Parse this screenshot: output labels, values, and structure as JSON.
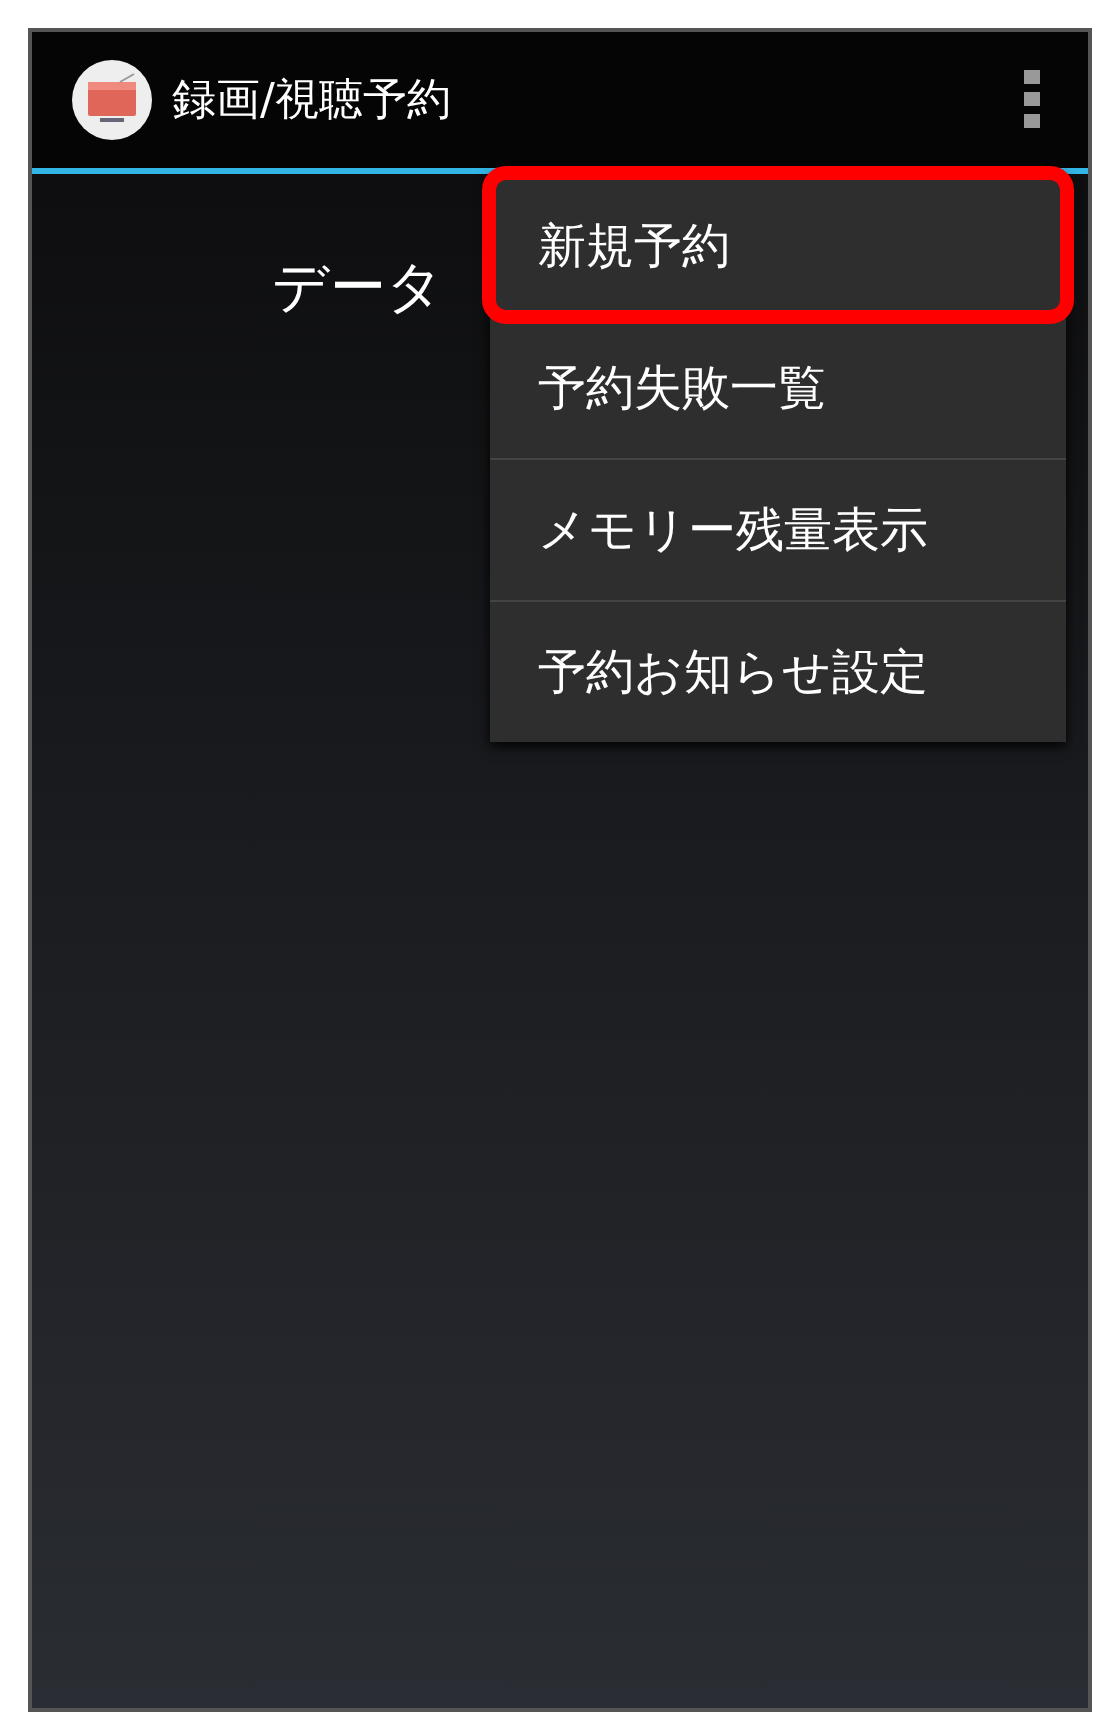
{
  "action_bar": {
    "title": "録画/視聴予約"
  },
  "body": {
    "message": "データ"
  },
  "menu": {
    "items": [
      {
        "label": "新規予約",
        "highlighted": true
      },
      {
        "label": "予約失敗一覧",
        "highlighted": false
      },
      {
        "label": "メモリー残量表示",
        "highlighted": false
      },
      {
        "label": "予約お知らせ設定",
        "highlighted": false
      }
    ]
  }
}
